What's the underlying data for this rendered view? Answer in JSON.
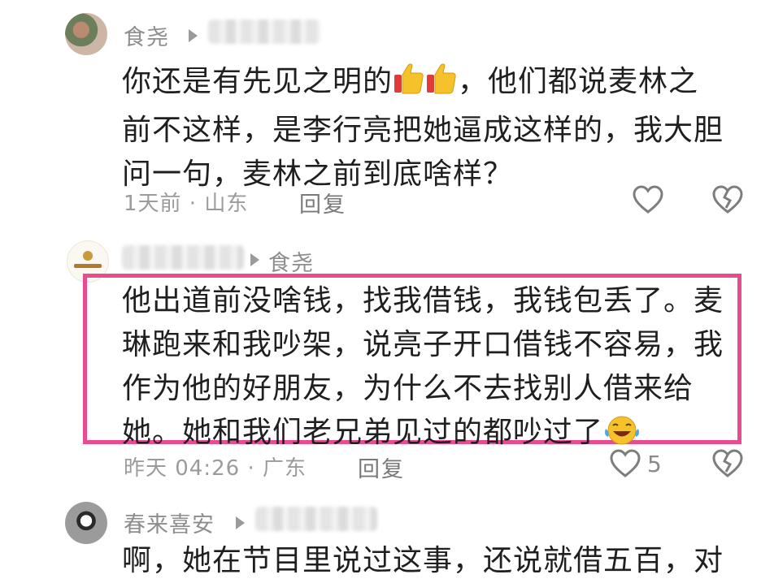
{
  "comments": [
    {
      "username": "食尧",
      "text": [
        "你还是有先见之明的",
        "，他们都说麦林之",
        "前不这样，是李行亮把她逼成这样的，我大胆",
        "问一句，麦林之前到底啥样？"
      ],
      "emoji": "thumbs-up",
      "time_location": "1天前 · 山东",
      "reply_label": "回复"
    },
    {
      "reply_to": "食尧",
      "text": [
        "他出道前没啥钱，找我借钱，我钱包丢了。麦",
        "琳跑来和我吵架，说亮子开口借钱不容易，我",
        "作为他的好朋友，为什么不去找别人借来给",
        "她。她和我们老兄弟见过的都吵过了"
      ],
      "emoji": "laughing-tears",
      "time_location": "昨天 04:26 · 广东",
      "reply_label": "回复",
      "likes": "5"
    },
    {
      "username": "春来喜安",
      "text": [
        "啊，她在节目里说过这事，还说就借五百，对"
      ]
    }
  ],
  "colors": {
    "highlight_border": "#e84b8e",
    "thumb_yellow": "#f5c22b",
    "thumb_red": "#e03a3a"
  }
}
